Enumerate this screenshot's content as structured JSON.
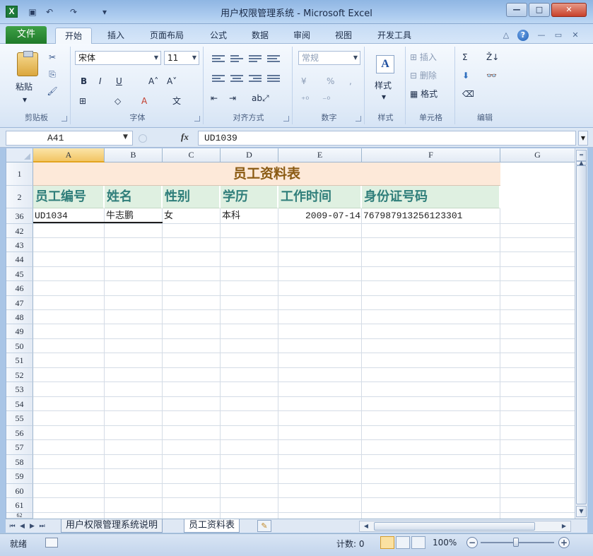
{
  "window": {
    "title": "用户权限管理系统 - Microsoft Excel",
    "app_icon": "X",
    "qat": {
      "save_icon": "▣",
      "undo_icon": "↶",
      "redo_icon": "↷",
      "customize_icon": "▾"
    },
    "controls": {
      "minimize": "—",
      "maximize": "□",
      "close": "✕"
    }
  },
  "ribbon_tabs": {
    "file": "文件",
    "tabs": [
      "开始",
      "插入",
      "页面布局",
      "公式",
      "数据",
      "审阅",
      "视图",
      "开发工具"
    ],
    "active_tab": "开始",
    "right_icons": {
      "collapse": "△",
      "help": "?",
      "min": "—",
      "restore": "▭",
      "close": "✕"
    }
  },
  "ribbon": {
    "clipboard": {
      "label": "剪贴板",
      "paste": "粘贴",
      "cut_icon": "✂",
      "copy_icon": "⎘",
      "format_painter_icon": "🖌"
    },
    "font": {
      "label": "字体",
      "font_name": "宋体",
      "font_size": "11",
      "bold": "B",
      "italic": "I",
      "underline": "U",
      "grow": "A˄",
      "shrink": "A˅",
      "border_icon": "⊞",
      "fill_icon": "◇",
      "font_color_icon": "A",
      "phonetic_icon": "文"
    },
    "alignment": {
      "label": "对齐方式",
      "indent_dec": "⇤",
      "indent_inc": "⇥",
      "orient_icon": "ab⤢"
    },
    "number": {
      "label": "数字",
      "format": "常规",
      "currency": "¥",
      "percent": "%",
      "comma": ",",
      "inc_dec": "⁺⁰",
      "dec_dec": "⁻⁰"
    },
    "styles": {
      "label": "样式",
      "button": "样式",
      "icon_letter": "A"
    },
    "cells": {
      "label": "单元格",
      "insert": "插入",
      "delete": "删除",
      "format": "格式"
    },
    "editing": {
      "label": "编辑",
      "sum": "Σ",
      "sort": "Ž↓",
      "fill": "⬇",
      "find": "👓",
      "clear": "⌫"
    }
  },
  "formula_bar": {
    "name_box": "A41",
    "fx": "fx",
    "formula": "UD1039"
  },
  "sheet": {
    "columns": [
      "A",
      "B",
      "C",
      "D",
      "E",
      "F",
      "G"
    ],
    "rows": [
      "1",
      "2",
      "36",
      "42",
      "43",
      "44",
      "45",
      "46",
      "47",
      "48",
      "49",
      "50",
      "51",
      "52",
      "53",
      "54",
      "55",
      "56",
      "57",
      "58",
      "59",
      "60",
      "61",
      "62"
    ],
    "title": "员工资料表",
    "headers": [
      "员工编号",
      "姓名",
      "性别",
      "学历",
      "工作时间",
      "身份证号码"
    ],
    "data_row": [
      "UD1034",
      "牛志鹏",
      "女",
      "本科",
      "2009-07-14",
      "767987913256123301"
    ]
  },
  "sheet_tabs": {
    "tabs": [
      "用户权限管理系统说明",
      "员工资料表"
    ],
    "active": "员工资料表",
    "new_sheet_icon": "✎"
  },
  "status": {
    "ready": "就绪",
    "count": "计数: 0",
    "zoom": "100%",
    "zoom_out": "−",
    "zoom_in": "+"
  }
}
